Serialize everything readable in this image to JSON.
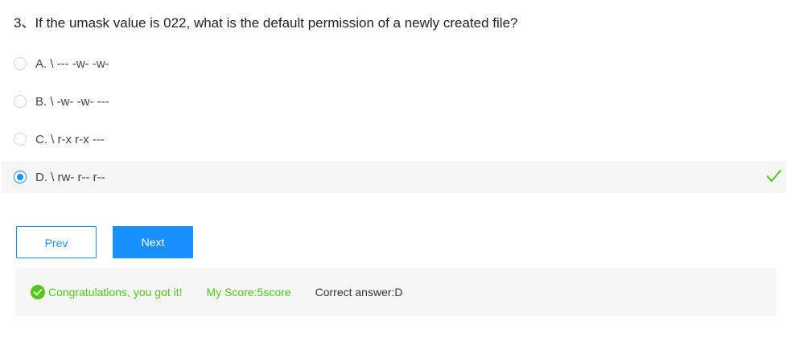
{
  "question": {
    "text": "3、If the umask value is 022, what is the default permission of a newly created file?"
  },
  "options": [
    {
      "label": "A. \\ --- -w- -w-",
      "selected": false
    },
    {
      "label": "B. \\ -w- -w- ---",
      "selected": false
    },
    {
      "label": "C. \\ r-x r-x ---",
      "selected": false
    },
    {
      "label": "D. \\ rw- r-- r--",
      "selected": true
    }
  ],
  "buttons": {
    "prev_label": "Prev",
    "next_label": "Next"
  },
  "result": {
    "congrats_text": "Congratulations, you got it!",
    "score_text": "My Score:5score",
    "answer_text": "Correct answer:D"
  },
  "colors": {
    "accent": "#1890ff",
    "success": "#52c41a",
    "panel_bg": "#f6f6f6"
  },
  "icons": {
    "correct_marker": "checkmark-icon",
    "result_status": "check-circle-icon"
  }
}
